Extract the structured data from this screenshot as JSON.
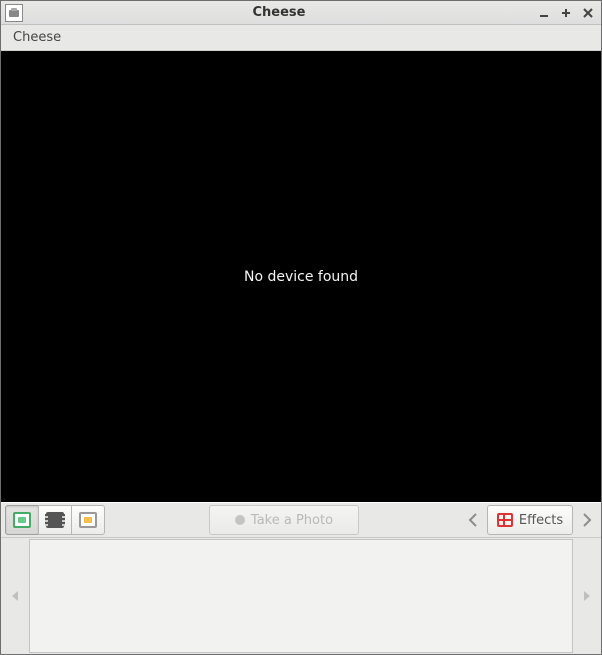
{
  "window": {
    "title": "Cheese"
  },
  "menubar": {
    "items": [
      {
        "label": "Cheese"
      }
    ]
  },
  "viewport": {
    "message": "No device found"
  },
  "toolbar": {
    "take_photo_label": "Take a Photo",
    "effects_label": "Effects"
  }
}
